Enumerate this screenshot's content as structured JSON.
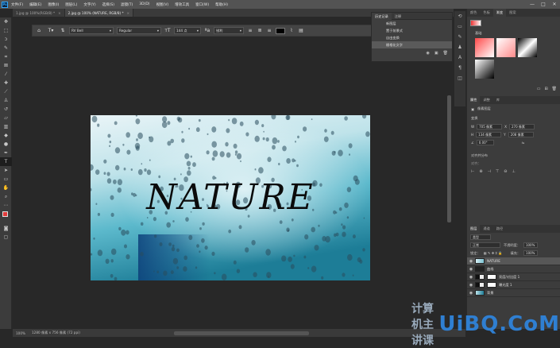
{
  "menubar": {
    "app_icon": "Ps",
    "items": [
      "文件(F)",
      "编辑(E)",
      "图像(I)",
      "图层(L)",
      "文字(Y)",
      "选择(S)",
      "滤镜(T)",
      "3D(D)",
      "视图(V)",
      "增效工具",
      "窗口(W)",
      "帮助(H)"
    ]
  },
  "window_controls": [
    "—",
    "□",
    "✕"
  ],
  "tabs": [
    {
      "label": "1.jpg @ 100%(RGB/8) *",
      "close": "×"
    },
    {
      "label": "2.jpg @ 100% (NATURE, RGB/8) *",
      "close": "×"
    }
  ],
  "options": {
    "font_family": "RV Bell",
    "font_style": "Regular",
    "font_size": "144 点",
    "antialias": "锐利",
    "dropdown_glyph": "▾"
  },
  "canvas": {
    "text": "NATURE"
  },
  "history": {
    "tabs": [
      "历史记录",
      "注释"
    ],
    "items": [
      "新图层",
      "置于前景式",
      "自由变换",
      "栅格化文字"
    ],
    "active_index": 3
  },
  "right_tabs_top": [
    "颜色",
    "色板",
    "渐变",
    "图案"
  ],
  "gradients_group": "基础",
  "properties": {
    "tabs": [
      "属性",
      "调整",
      "库"
    ],
    "section_title": "像素图层",
    "transform_label": "变换",
    "w": "705 像素",
    "x": "270 像素",
    "h": "134 像素",
    "y": "208 像素",
    "angle": "0.00°",
    "align_label": "对齐并分布",
    "align_sub": "对齐："
  },
  "layers": {
    "tabs": [
      "图层",
      "通道",
      "路径"
    ],
    "filter": "类型",
    "blend": "正常",
    "opacity_label": "不透明度：",
    "opacity": "100%",
    "lock_label": "锁定：",
    "fill_label": "填充：",
    "fill": "100%",
    "rows": [
      {
        "name": "NATURE",
        "active": true
      },
      {
        "name": "曲线",
        "active": false
      },
      {
        "name": "亮度/对比度 1",
        "active": false
      },
      {
        "name": "曝光度 1",
        "active": false
      },
      {
        "name": "背景",
        "active": false
      }
    ]
  },
  "status": {
    "zoom": "100%",
    "doc_info": "1280 像素 x 756 像素 (72 ppi)"
  },
  "watermark": {
    "logo": "UiBQ.CoM",
    "chinese": "计算机主讲课"
  }
}
